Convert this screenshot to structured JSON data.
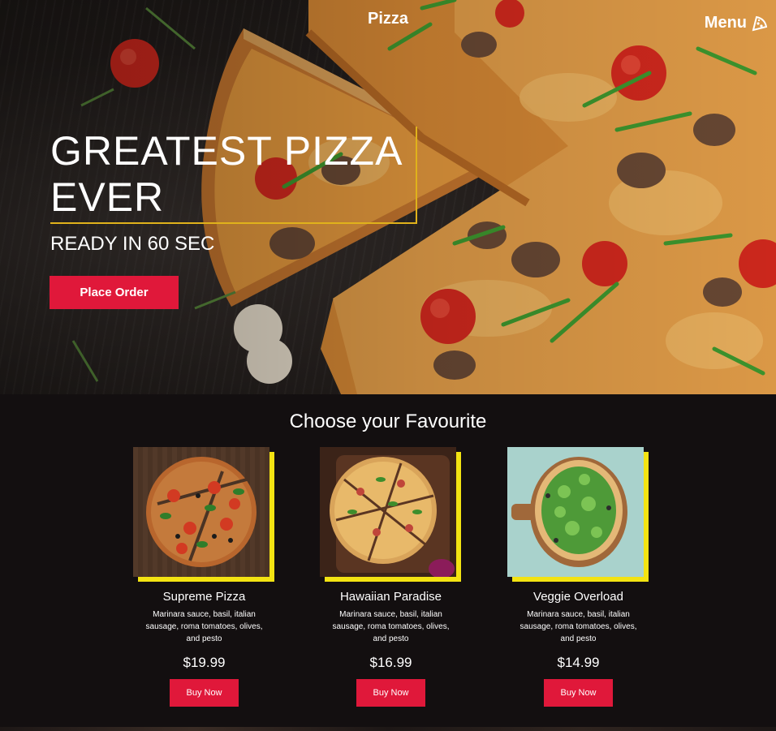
{
  "header": {
    "brand": "Pizza",
    "menu_label": "Menu",
    "menu_icon": "pizza-slice-icon"
  },
  "hero": {
    "headline": "GREATEST PIZZA EVER",
    "subline": "READY IN 60 SEC",
    "order_button": "Place Order",
    "accent_color": "#e0b21b"
  },
  "favourites": {
    "title": "Choose your Favourite",
    "items": [
      {
        "name": "Supreme Pizza",
        "description": "Marinara sauce, basil, italian sausage, roma tomatoes, olives, and pesto",
        "price": "$19.99",
        "button": "Buy Now"
      },
      {
        "name": "Hawaiian Paradise",
        "description": "Marinara sauce, basil, italian sausage, roma tomatoes, olives, and pesto",
        "price": "$16.99",
        "button": "Buy Now"
      },
      {
        "name": "Veggie Overload",
        "description": "Marinara sauce, basil, italian sausage, roma tomatoes, olives, and pesto",
        "price": "$14.99",
        "button": "Buy Now"
      }
    ]
  },
  "colors": {
    "button_red": "#e0183a",
    "card_accent_yellow": "#f3e312",
    "page_background": "#130f10"
  }
}
